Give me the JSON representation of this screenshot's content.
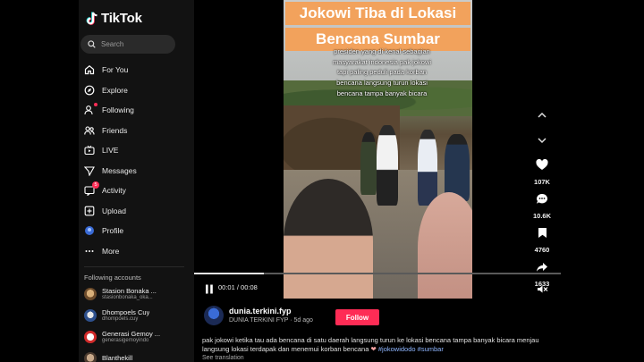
{
  "app": {
    "name": "TikTok"
  },
  "search": {
    "placeholder": "Search"
  },
  "nav": [
    {
      "label": "For You",
      "icon": "home-icon"
    },
    {
      "label": "Explore",
      "icon": "compass-icon"
    },
    {
      "label": "Following",
      "icon": "following-icon"
    },
    {
      "label": "Friends",
      "icon": "friends-icon"
    },
    {
      "label": "LIVE",
      "icon": "live-icon"
    },
    {
      "label": "Messages",
      "icon": "messages-icon"
    },
    {
      "label": "Activity",
      "icon": "activity-icon",
      "badge": "5"
    },
    {
      "label": "Upload",
      "icon": "upload-icon"
    },
    {
      "label": "Profile",
      "icon": "profile-icon"
    },
    {
      "label": "More",
      "icon": "more-icon"
    }
  ],
  "following_accounts": {
    "title": "Following accounts",
    "items": [
      {
        "name": "Stasion Bonaka ...",
        "handle": "stasionbonaka_oka..."
      },
      {
        "name": "Dhompoels Cuy",
        "handle": "dhompoels.cuy"
      },
      {
        "name": "Generasi Gemoy ...",
        "handle": "generasigemoyindo"
      },
      {
        "name": "Blanthekill",
        "handle": ""
      }
    ]
  },
  "video": {
    "title_line1": "Jokowi Tiba di Lokasi",
    "title_line2": "Bencana Sumbar",
    "overlay_text": "presiden yang di kenal sebagian masyarakat indonesia pak jokowi tapi paling peduli pada korban bencana langsung turun lokasi bencana tampa banyak bicara",
    "time": "00:01 / 00:08",
    "progress": 0.19,
    "title_bg": "#f2a25c"
  },
  "actions": {
    "likes": "107K",
    "comments": "10.6K",
    "saves": "4760",
    "shares": "1633"
  },
  "creator": {
    "username": "dunia.terkini.fyp",
    "display": "DUNIA TERKINI FYP",
    "separator": "·",
    "age": "5d ago",
    "follow_label": "Follow"
  },
  "caption": {
    "text": "pak jokowi ketika tau ada bencana di satu daerah langsung turun ke lokasi bencana tampa banyak bicara menjau langsung lokasi terdapak dan menemui korban bencana",
    "tags": "#jokowidodo #sumbar",
    "see_translation": "See translation"
  },
  "colors": {
    "accent": "#fe2c55",
    "sidebar": "#121212",
    "tag": "#8fb6ff"
  }
}
